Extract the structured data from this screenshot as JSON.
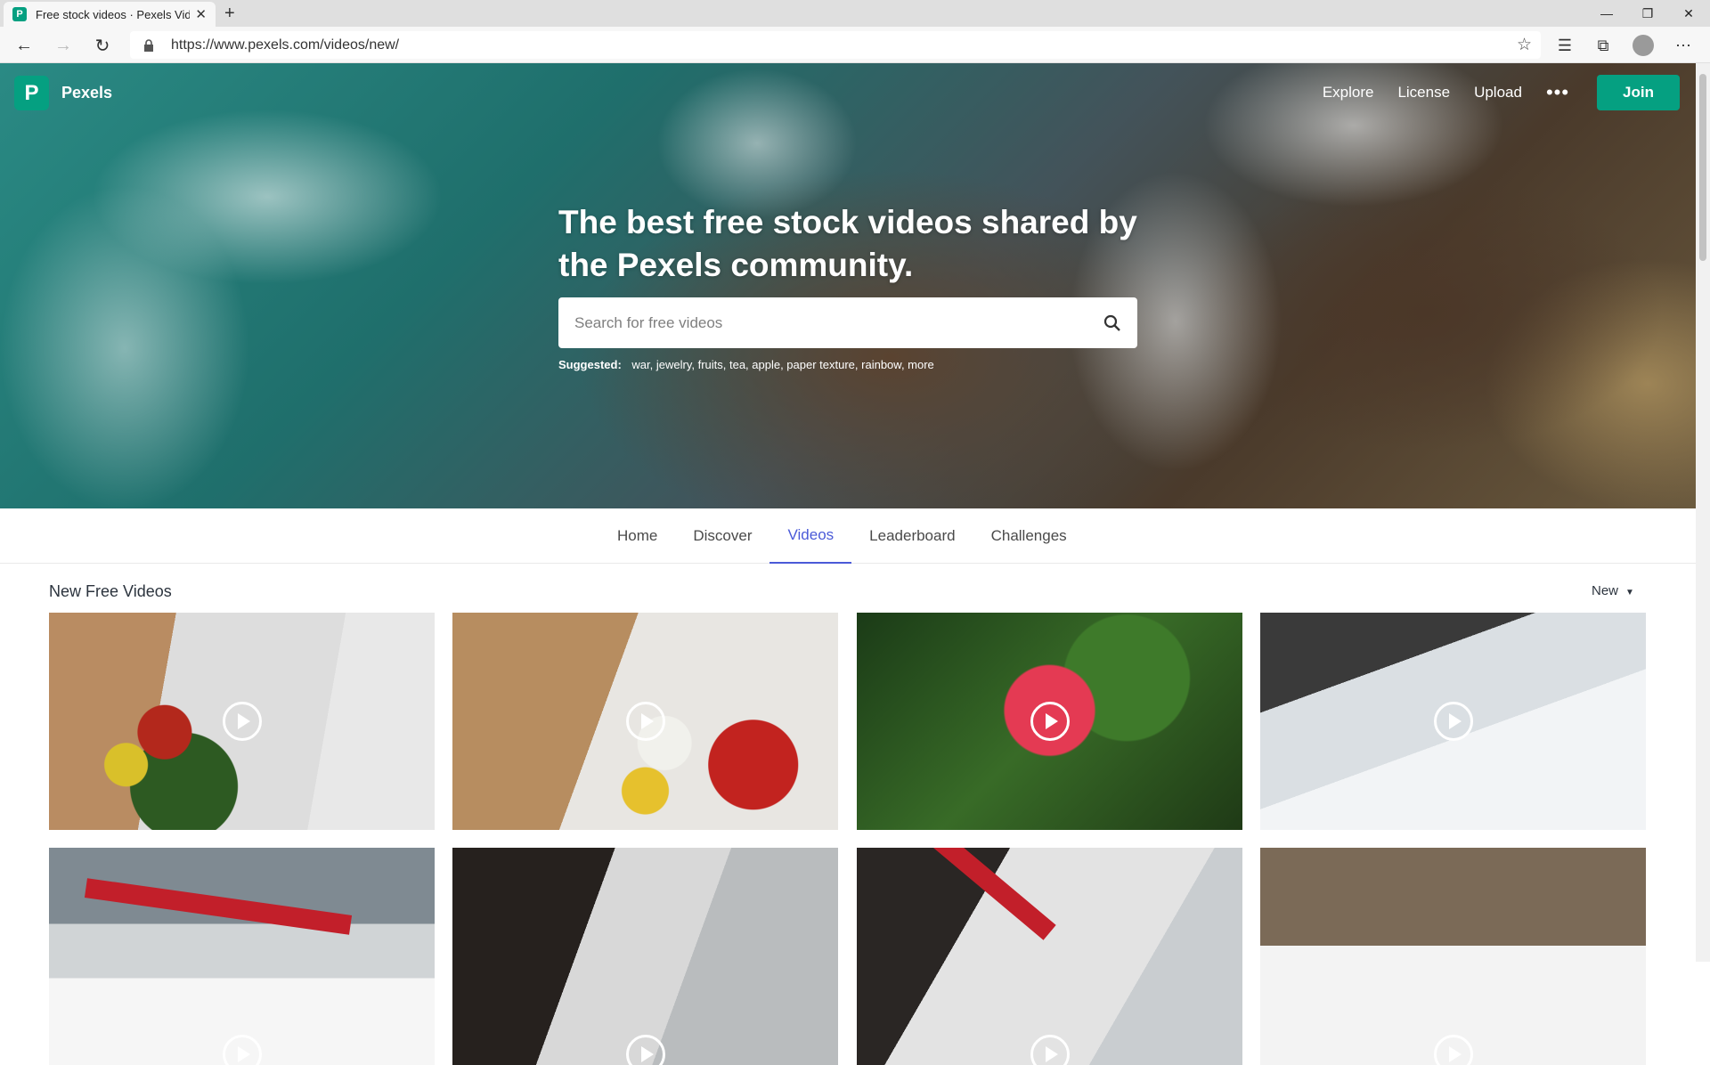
{
  "browser": {
    "tab_title": "Free stock videos · Pexels Videos",
    "tab_favicon_letter": "P",
    "url": "https://www.pexels.com/videos/new/",
    "new_tab": "+",
    "close_tab": "✕"
  },
  "header": {
    "logo_letter": "P",
    "brand": "Pexels",
    "nav": [
      "Explore",
      "License",
      "Upload"
    ],
    "more": "•••",
    "join_label": "Join"
  },
  "hero": {
    "headline": "The best free stock videos shared by the Pexels community.",
    "search_placeholder": "Search for free videos",
    "suggested_label": "Suggested:",
    "suggested_terms": "war, jewelry, fruits, tea, apple, paper texture, rainbow, more"
  },
  "subnav": {
    "tabs": [
      "Home",
      "Discover",
      "Videos",
      "Leaderboard",
      "Challenges"
    ],
    "active": "Videos"
  },
  "content": {
    "section_title": "New Free Videos",
    "sort_label": "New"
  },
  "colors": {
    "brand": "#05a081",
    "active_tab": "#4a5ad8"
  }
}
